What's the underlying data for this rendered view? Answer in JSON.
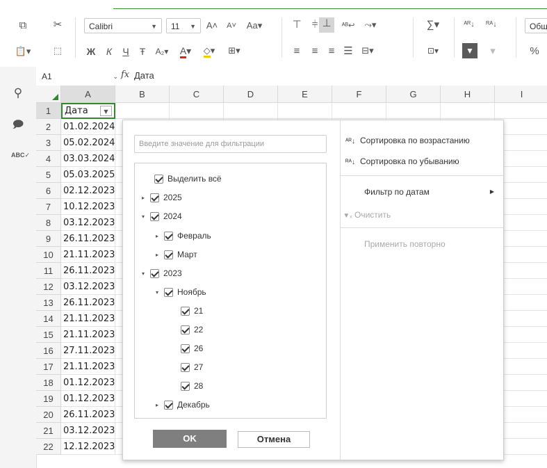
{
  "toolbar": {
    "font_name": "Calibri",
    "font_size": "11",
    "number_format": "Общ",
    "icons": [
      "copy-icon",
      "cut-icon",
      "paste-icon",
      "select-icon",
      "bold-icon",
      "italic-icon",
      "underline-icon",
      "strikethrough-icon",
      "subscript-icon",
      "font-color-icon",
      "fill-color-icon",
      "borders-icon",
      "increase-font-icon",
      "decrease-font-icon",
      "change-case-icon",
      "align-top-icon",
      "align-middle-icon",
      "align-bottom-icon",
      "wrap-text-icon",
      "text-orientation-icon",
      "align-left-icon",
      "align-center-icon",
      "align-right-icon",
      "justify-icon",
      "merge-icon",
      "sum-icon",
      "named-range-icon",
      "sort-asc-icon",
      "sort-desc-icon",
      "filter-icon",
      "clear-filter-icon",
      "percent-icon"
    ],
    "labels": {
      "bold": "Ж",
      "italic": "К",
      "underline": "Ч",
      "strike": "Ŧ",
      "subscript": "A₂",
      "increase": "A",
      "decrease": "A",
      "case": "Aa",
      "sum": "∑",
      "percent": "%"
    }
  },
  "formula_bar": {
    "cell_ref": "A1",
    "fx": "fx",
    "value": "Дата"
  },
  "grid": {
    "columns": [
      "A",
      "B",
      "C",
      "D",
      "E",
      "F",
      "G",
      "H",
      "I"
    ],
    "rows": [
      {
        "n": "1",
        "a": "Дата"
      },
      {
        "n": "2",
        "a": "01.02.2024"
      },
      {
        "n": "3",
        "a": "05.02.2024"
      },
      {
        "n": "4",
        "a": "03.03.2024"
      },
      {
        "n": "5",
        "a": "05.03.2025"
      },
      {
        "n": "6",
        "a": "02.12.2023"
      },
      {
        "n": "7",
        "a": "10.12.2023"
      },
      {
        "n": "8",
        "a": "03.12.2023"
      },
      {
        "n": "9",
        "a": "26.11.2023"
      },
      {
        "n": "10",
        "a": "21.11.2023"
      },
      {
        "n": "11",
        "a": "26.11.2023"
      },
      {
        "n": "12",
        "a": "03.12.2023"
      },
      {
        "n": "13",
        "a": "26.11.2023"
      },
      {
        "n": "14",
        "a": "21.11.2023"
      },
      {
        "n": "15",
        "a": "21.11.2023"
      },
      {
        "n": "16",
        "a": "27.11.2023"
      },
      {
        "n": "17",
        "a": "21.11.2023"
      },
      {
        "n": "18",
        "a": "01.12.2023"
      },
      {
        "n": "19",
        "a": "01.12.2023"
      },
      {
        "n": "20",
        "a": "26.11.2023"
      },
      {
        "n": "21",
        "a": "03.12.2023"
      },
      {
        "n": "22",
        "a": "12.12.2023"
      }
    ]
  },
  "filter": {
    "search_placeholder": "Введите значение для фильтрации",
    "tree": [
      {
        "label": "Выделить всё",
        "level": 0,
        "caret": "",
        "checked": true
      },
      {
        "label": "2025",
        "level": 0,
        "caret": "▸",
        "checked": true
      },
      {
        "label": "2024",
        "level": 0,
        "caret": "▾",
        "checked": true
      },
      {
        "label": "Февраль",
        "level": 1,
        "caret": "▸",
        "checked": true
      },
      {
        "label": "Март",
        "level": 1,
        "caret": "▸",
        "checked": true
      },
      {
        "label": "2023",
        "level": 0,
        "caret": "▾",
        "checked": true
      },
      {
        "label": "Ноябрь",
        "level": 1,
        "caret": "▾",
        "checked": true
      },
      {
        "label": "21",
        "level": 2,
        "caret": "",
        "checked": true
      },
      {
        "label": "22",
        "level": 2,
        "caret": "",
        "checked": true
      },
      {
        "label": "26",
        "level": 2,
        "caret": "",
        "checked": true
      },
      {
        "label": "27",
        "level": 2,
        "caret": "",
        "checked": true
      },
      {
        "label": "28",
        "level": 2,
        "caret": "",
        "checked": true
      },
      {
        "label": "Декабрь",
        "level": 1,
        "caret": "▸",
        "checked": true
      }
    ],
    "ok_label": "OK",
    "cancel_label": "Отмена",
    "menu": {
      "sort_asc": "Сортировка по возрастанию",
      "sort_desc": "Сортировка по убыванию",
      "date_filter": "Фильтр по датам",
      "clear": "Очистить",
      "reapply": "Применить повторно"
    }
  },
  "colors": {
    "accent": "#3a8a3a",
    "header_bg": "#f4f4f4",
    "ok_bg": "#7f7f7f"
  }
}
